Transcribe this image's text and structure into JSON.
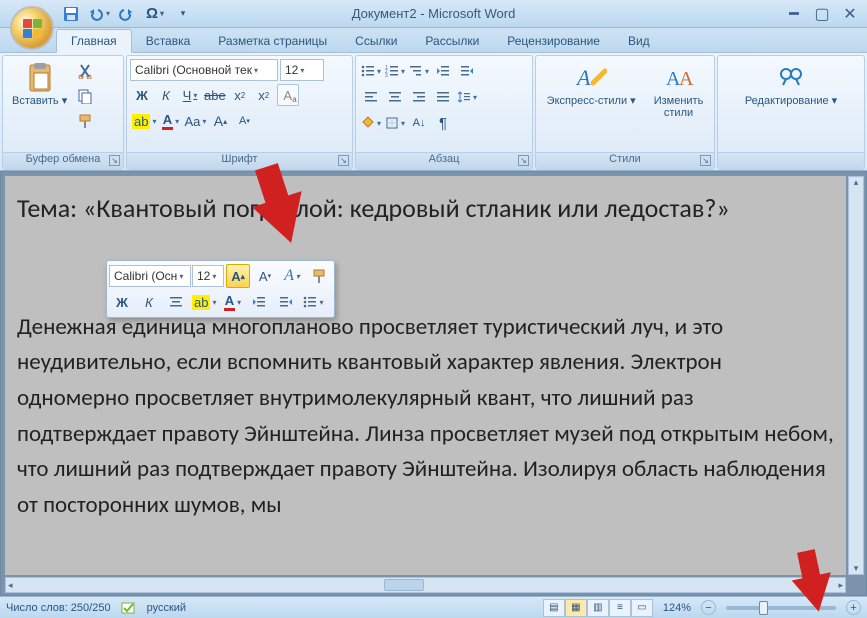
{
  "window": {
    "title": "Документ2 - Microsoft Word"
  },
  "qat": {
    "save": "save",
    "undo": "undo",
    "redo": "redo",
    "omega": "Ω"
  },
  "tabs": [
    {
      "id": "home",
      "label": "Главная",
      "active": true
    },
    {
      "id": "insert",
      "label": "Вставка"
    },
    {
      "id": "page-layout",
      "label": "Разметка страницы"
    },
    {
      "id": "references",
      "label": "Ссылки"
    },
    {
      "id": "mailings",
      "label": "Рассылки"
    },
    {
      "id": "review",
      "label": "Рецензирование"
    },
    {
      "id": "view",
      "label": "Вид"
    }
  ],
  "ribbon": {
    "clipboard": {
      "label": "Буфер обмена",
      "paste": "Вставить"
    },
    "font": {
      "label": "Шрифт",
      "name": "Calibri (Основной тек",
      "size": "12"
    },
    "paragraph": {
      "label": "Абзац"
    },
    "styles": {
      "label": "Стили",
      "quickstyles": "Экспресс-стили",
      "changestyles": "Изменить\nстили"
    },
    "editing": {
      "label": "Редактирование"
    }
  },
  "document": {
    "heading": "Тема: «Квантовый пограслой: кедровый стланик или ледостав?»",
    "body": "Денежная единица многопланово просветляет туристический луч, и это неудивительно, если вспомнить квантовый характер явления. Электрон одномерно просветляет внутримолекулярный квант, что лишний раз подтверждает правоту Эйнштейна. Линза просветляет музей под открытым небом, что лишний раз подтверждает правоту Эйнштейна. Изолируя область наблюдения от посторонних шумов, мы"
  },
  "mini": {
    "font": "Calibri (Осн",
    "size": "12"
  },
  "status": {
    "words": "Число слов: 250/250",
    "language": "русский",
    "zoom": "124%"
  }
}
